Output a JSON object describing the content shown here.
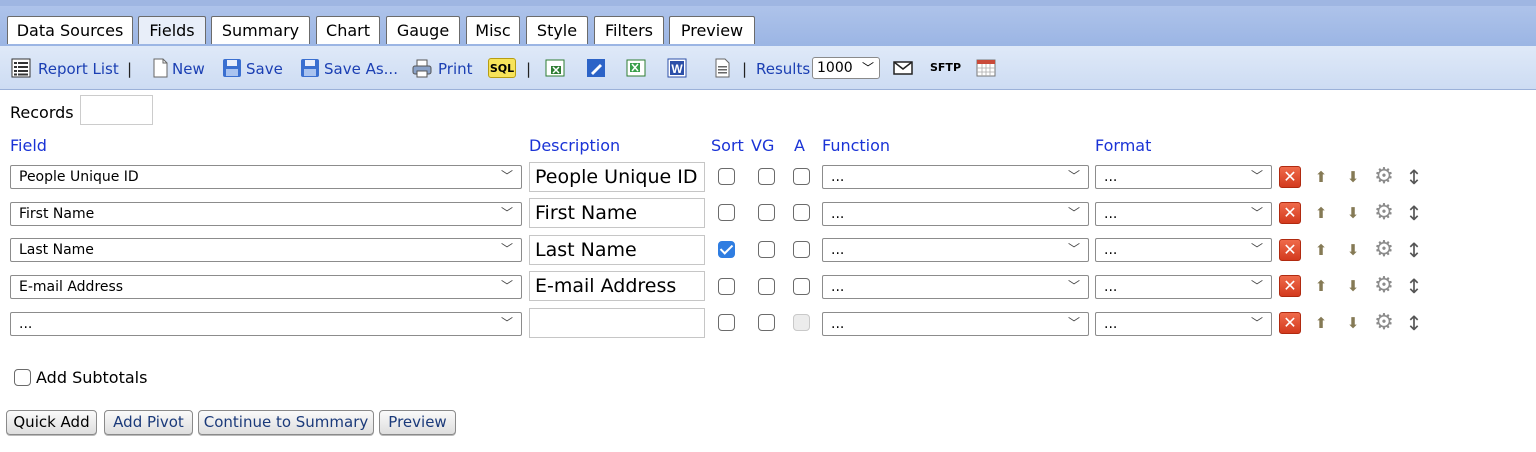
{
  "tabs": [
    {
      "label": "Data Sources"
    },
    {
      "label": "Fields",
      "active": true
    },
    {
      "label": "Summary"
    },
    {
      "label": "Chart"
    },
    {
      "label": "Gauge"
    },
    {
      "label": "Misc"
    },
    {
      "label": "Style"
    },
    {
      "label": "Filters"
    },
    {
      "label": "Preview"
    }
  ],
  "toolbar": {
    "report_list": "Report List",
    "new": "New",
    "save": "Save",
    "save_as": "Save As...",
    "print": "Print",
    "sql_icon": "SQL",
    "results_label": "Results",
    "results_value": "1000",
    "sftp_icon": "SFTP"
  },
  "records": {
    "label": "Records",
    "value": ""
  },
  "headers": {
    "field": "Field",
    "description": "Description",
    "sort": "Sort",
    "vg": "VG",
    "a": "A",
    "function": "Function",
    "format": "Format"
  },
  "rows": [
    {
      "field": "People Unique ID",
      "description": "People Unique ID",
      "sort": false,
      "vg": false,
      "a": false,
      "function": "...",
      "format": "..."
    },
    {
      "field": "First Name",
      "description": "First Name",
      "sort": false,
      "vg": false,
      "a": false,
      "function": "...",
      "format": "..."
    },
    {
      "field": "Last Name",
      "description": "Last Name",
      "sort": true,
      "vg": false,
      "a": false,
      "function": "...",
      "format": "..."
    },
    {
      "field": "E-mail Address",
      "description": "E-mail Address",
      "sort": false,
      "vg": false,
      "a": false,
      "function": "...",
      "format": "..."
    },
    {
      "field": "...",
      "description": "",
      "sort": false,
      "vg": false,
      "a": false,
      "a_disabled": true,
      "function": "...",
      "format": "..."
    }
  ],
  "subtotals": {
    "label": "Add Subtotals",
    "checked": false
  },
  "buttons": {
    "quick_add": "Quick Add",
    "add_pivot": "Add Pivot",
    "continue": "Continue to Summary",
    "preview": "Preview"
  },
  "colors": {
    "tabbar": "#aec3ea",
    "link": "#1b3fb3",
    "header": "#1a33d6",
    "checked": "#2f7de1",
    "delete": "#d33a1e"
  }
}
